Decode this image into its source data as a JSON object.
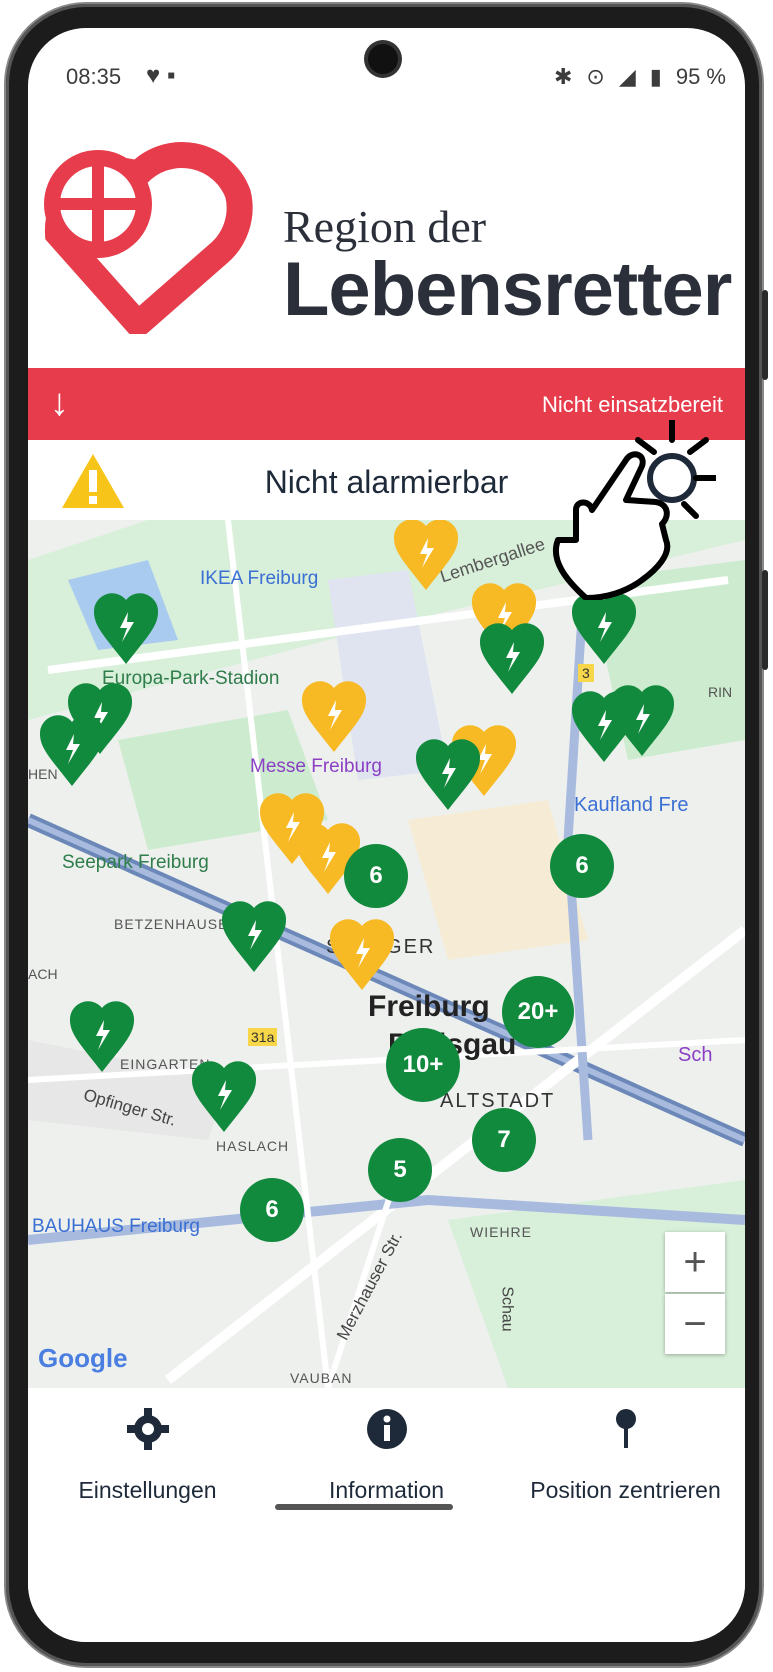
{
  "status_bar": {
    "time": "08:35",
    "battery": "95 %"
  },
  "logo": {
    "line1": "Region der",
    "line2": "Lebensretter"
  },
  "readiness_bar": {
    "status": "Nicht einsatzbereit",
    "color": "#e63c4b"
  },
  "alert": {
    "message": "Nicht alarmierbar"
  },
  "map": {
    "labels": {
      "ikea": "IKEA Freiburg",
      "lembergallee": "Lembergallee",
      "stadion": "Europa-Park-Stadion",
      "messe": "Messe Freiburg",
      "kaufland": "Kaufland Fre",
      "seepark": "Seepark Freiburg",
      "betzenhausen": "BETZENHAUSEN",
      "stuehlinger": "S  LINGER",
      "city": "Freiburg",
      "city2": "Breisgau",
      "altstadt": "ALTSTADT",
      "weingarten": "EINGARTEN",
      "opfinger": "Opfinger Str.",
      "haslach": "HASLACH",
      "bauhaus": "BAUHAUS Freiburg",
      "wiehre": "WIEHRE",
      "merzhauser": "Merzhauser Str.",
      "schau": "Schau",
      "vauban": "VAUBAN",
      "rin": "RIN",
      "hen": "HEN",
      "ach": "ACH",
      "sch": "Sch",
      "road_31a": "31a",
      "road_3": "3"
    },
    "clusters": [
      "6",
      "6",
      "20+",
      "10+",
      "7",
      "5",
      "6"
    ],
    "zoom_in": "+",
    "zoom_out": "−",
    "attribution": "Google"
  },
  "nav": {
    "settings": "Einstellungen",
    "information": "Information",
    "center": "Position zentrieren"
  },
  "colors": {
    "green": "#128a3e",
    "yellow": "#f7b924",
    "red": "#e63c4b",
    "navy": "#1e2a3a"
  }
}
